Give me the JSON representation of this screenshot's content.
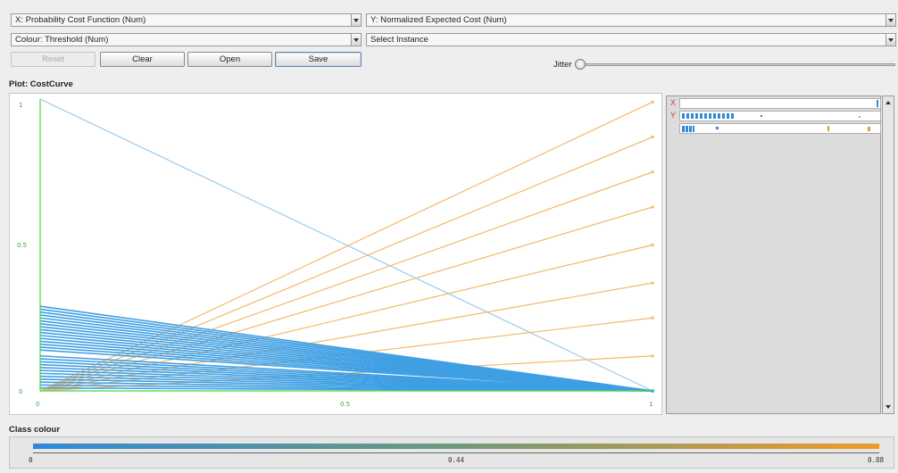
{
  "controls": {
    "x_axis": "X: Probability Cost Function (Num)",
    "y_axis": "Y: Normalized Expected Cost (Num)",
    "colour": "Colour: Threshold (Num)",
    "instance": "Select Instance",
    "reset": "Reset",
    "clear": "Clear",
    "open": "Open",
    "save": "Save",
    "jitter": "Jitter"
  },
  "plot": {
    "title": "Plot: CostCurve",
    "x_ticks": [
      "0",
      "0.5",
      "1"
    ],
    "y_ticks": [
      "1",
      "0.5",
      "0"
    ],
    "legend_x": "X",
    "legend_y": "Y"
  },
  "chart_data": {
    "type": "line",
    "title": "",
    "xlabel": "",
    "ylabel": "",
    "xlim": [
      0,
      1
    ],
    "ylim": [
      0,
      1
    ],
    "grid": false,
    "colors": {
      "blue": "#3f9fe3",
      "lightblue": "#9ccbea",
      "orange": "#f5b86a",
      "green": "#3fd93f"
    },
    "series": [
      {
        "color": "lightblue",
        "x": [
          0,
          1
        ],
        "y": [
          1,
          0
        ]
      },
      {
        "color": "orange",
        "x": [
          0,
          1
        ],
        "y": [
          0,
          0.99
        ]
      },
      {
        "color": "orange",
        "x": [
          0,
          1
        ],
        "y": [
          0,
          0.87
        ]
      },
      {
        "color": "orange",
        "x": [
          0,
          1
        ],
        "y": [
          0,
          0.75
        ]
      },
      {
        "color": "orange",
        "x": [
          0,
          1
        ],
        "y": [
          0,
          0.63
        ]
      },
      {
        "color": "orange",
        "x": [
          0,
          1
        ],
        "y": [
          0,
          0.5
        ]
      },
      {
        "color": "orange",
        "x": [
          0,
          1
        ],
        "y": [
          0,
          0.37
        ]
      },
      {
        "color": "orange",
        "x": [
          0,
          1
        ],
        "y": [
          0,
          0.25
        ]
      },
      {
        "color": "orange",
        "x": [
          0,
          1
        ],
        "y": [
          0,
          0.12
        ]
      },
      {
        "color": "blue",
        "x": [
          0,
          1
        ],
        "y": [
          0.29,
          0
        ]
      },
      {
        "color": "blue",
        "x": [
          0,
          1
        ],
        "y": [
          0.28,
          0
        ]
      },
      {
        "color": "blue",
        "x": [
          0,
          1
        ],
        "y": [
          0.27,
          0
        ]
      },
      {
        "color": "blue",
        "x": [
          0,
          1
        ],
        "y": [
          0.26,
          0
        ]
      },
      {
        "color": "blue",
        "x": [
          0,
          1
        ],
        "y": [
          0.25,
          0
        ]
      },
      {
        "color": "blue",
        "x": [
          0,
          1
        ],
        "y": [
          0.24,
          0
        ]
      },
      {
        "color": "blue",
        "x": [
          0,
          1
        ],
        "y": [
          0.23,
          0
        ]
      },
      {
        "color": "blue",
        "x": [
          0,
          1
        ],
        "y": [
          0.22,
          0
        ]
      },
      {
        "color": "blue",
        "x": [
          0,
          1
        ],
        "y": [
          0.21,
          0
        ]
      },
      {
        "color": "blue",
        "x": [
          0,
          1
        ],
        "y": [
          0.2,
          0
        ]
      },
      {
        "color": "blue",
        "x": [
          0,
          1
        ],
        "y": [
          0.19,
          0
        ]
      },
      {
        "color": "blue",
        "x": [
          0,
          1
        ],
        "y": [
          0.18,
          0
        ]
      },
      {
        "color": "blue",
        "x": [
          0,
          1
        ],
        "y": [
          0.17,
          0
        ]
      },
      {
        "color": "blue",
        "x": [
          0,
          1
        ],
        "y": [
          0.16,
          0
        ]
      },
      {
        "color": "blue",
        "x": [
          0,
          1
        ],
        "y": [
          0.15,
          0
        ]
      },
      {
        "color": "blue",
        "x": [
          0,
          1
        ],
        "y": [
          0.14,
          0
        ]
      },
      {
        "color": "blue",
        "x": [
          0,
          1
        ],
        "y": [
          0.12,
          0
        ]
      },
      {
        "color": "blue",
        "x": [
          0,
          1
        ],
        "y": [
          0.11,
          0
        ]
      },
      {
        "color": "blue",
        "x": [
          0,
          1
        ],
        "y": [
          0.1,
          0
        ]
      },
      {
        "color": "blue",
        "x": [
          0,
          1
        ],
        "y": [
          0.09,
          0
        ]
      },
      {
        "color": "blue",
        "x": [
          0,
          1
        ],
        "y": [
          0.08,
          0
        ]
      },
      {
        "color": "blue",
        "x": [
          0,
          1
        ],
        "y": [
          0.07,
          0
        ]
      },
      {
        "color": "blue",
        "x": [
          0,
          1
        ],
        "y": [
          0.06,
          0
        ]
      },
      {
        "color": "blue",
        "x": [
          0,
          1
        ],
        "y": [
          0.05,
          0
        ]
      },
      {
        "color": "blue",
        "x": [
          0,
          1
        ],
        "y": [
          0.04,
          0
        ]
      },
      {
        "color": "blue",
        "x": [
          0,
          1
        ],
        "y": [
          0.03,
          0
        ]
      },
      {
        "color": "blue",
        "x": [
          0,
          1
        ],
        "y": [
          0.02,
          0
        ]
      },
      {
        "color": "blue",
        "x": [
          0,
          1
        ],
        "y": [
          0.01,
          0
        ]
      }
    ]
  },
  "class_colour": {
    "title": "Class colour",
    "ticks": [
      "0",
      "0.44",
      "0.88"
    ],
    "gradient_colors": [
      "#2f8ad8",
      "#f09a28"
    ]
  }
}
